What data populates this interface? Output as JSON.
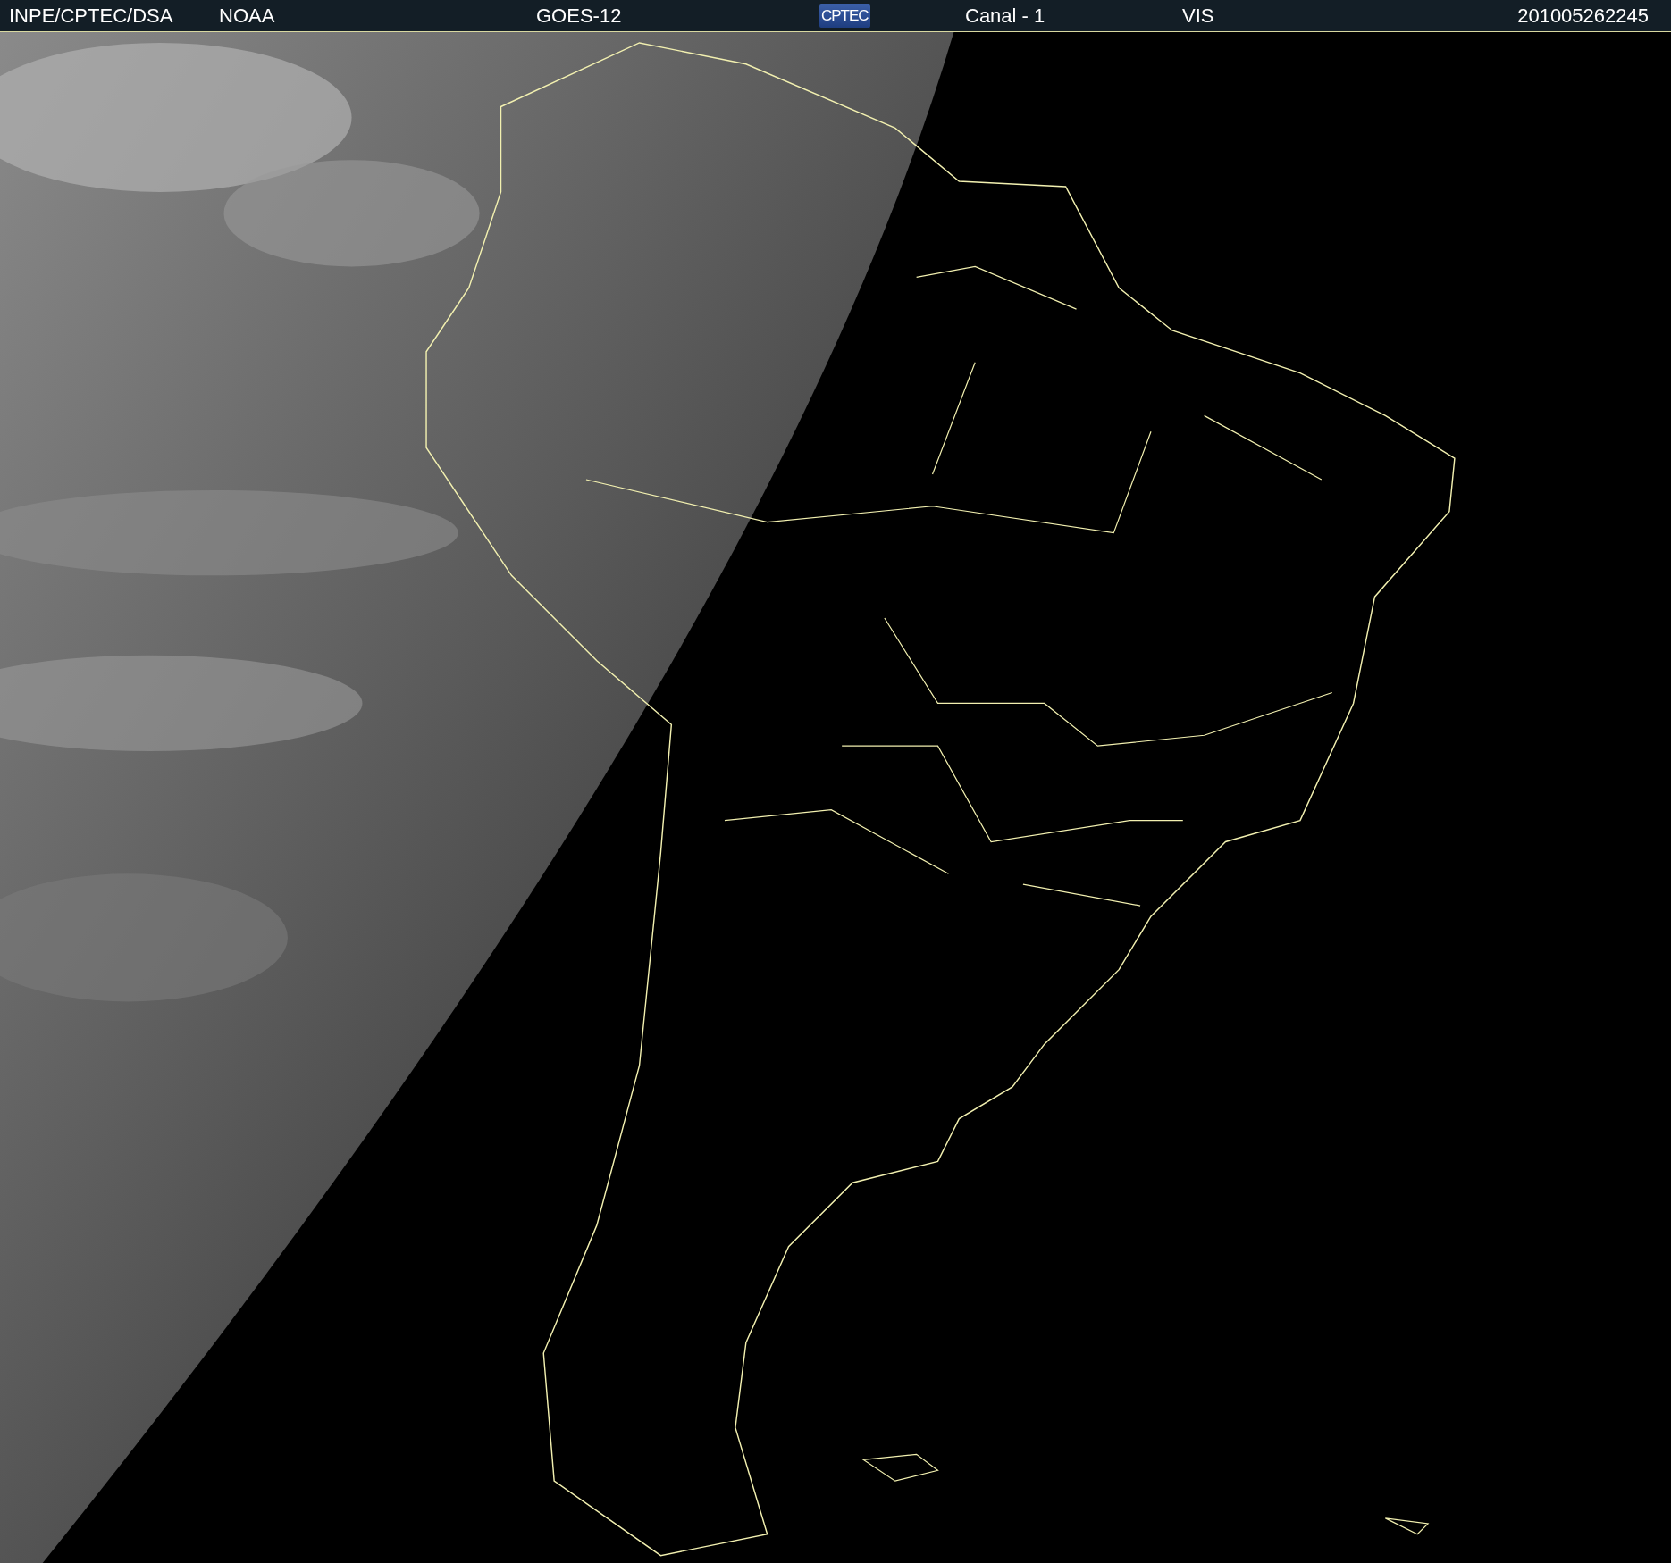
{
  "header": {
    "items": [
      {
        "kind": "text",
        "text": "INPE/CPTEC/DSA"
      },
      {
        "kind": "text",
        "text": "NOAA"
      },
      {
        "kind": "text",
        "text": "GOES-12"
      },
      {
        "kind": "logo",
        "text": "CPTEC"
      },
      {
        "kind": "text",
        "text": "Canal - 1"
      },
      {
        "kind": "text",
        "text": "VIS"
      },
      {
        "kind": "time",
        "text": "201005262245"
      }
    ]
  }
}
